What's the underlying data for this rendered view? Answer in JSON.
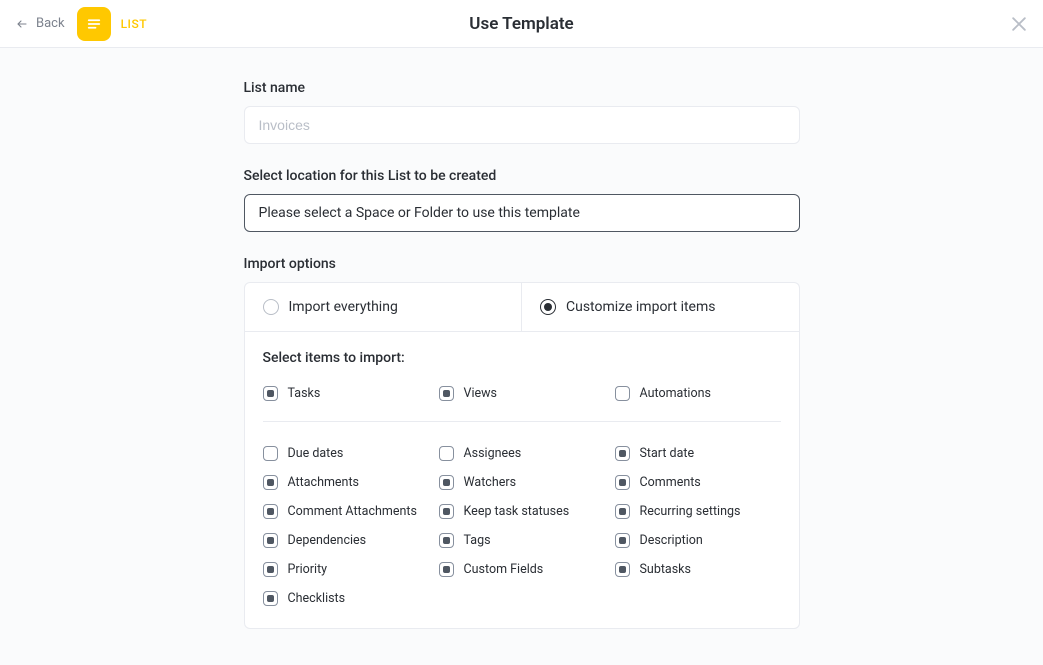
{
  "header": {
    "back_label": "Back",
    "badge_label": "LIST",
    "title": "Use Template"
  },
  "list_name": {
    "label": "List name",
    "placeholder": "Invoices",
    "value": ""
  },
  "location": {
    "label": "Select location for this List to be created",
    "placeholder": "Please select a Space or Folder to use this template"
  },
  "import": {
    "label": "Import options",
    "option_everything": "Import everything",
    "option_customize": "Customize import items",
    "selected": "customize",
    "panel_heading": "Select items to import:",
    "items_top": [
      {
        "label": "Tasks",
        "checked": true
      },
      {
        "label": "Views",
        "checked": true
      },
      {
        "label": "Automations",
        "checked": false
      }
    ],
    "items_rest": [
      {
        "label": "Due dates",
        "checked": false
      },
      {
        "label": "Assignees",
        "checked": false
      },
      {
        "label": "Start date",
        "checked": true
      },
      {
        "label": "Attachments",
        "checked": true
      },
      {
        "label": "Watchers",
        "checked": true
      },
      {
        "label": "Comments",
        "checked": true
      },
      {
        "label": "Comment Attachments",
        "checked": true
      },
      {
        "label": "Keep task statuses",
        "checked": true
      },
      {
        "label": "Recurring settings",
        "checked": true
      },
      {
        "label": "Dependencies",
        "checked": true
      },
      {
        "label": "Tags",
        "checked": true
      },
      {
        "label": "Description",
        "checked": true
      },
      {
        "label": "Priority",
        "checked": true
      },
      {
        "label": "Custom Fields",
        "checked": true
      },
      {
        "label": "Subtasks",
        "checked": true
      },
      {
        "label": "Checklists",
        "checked": true
      }
    ]
  }
}
